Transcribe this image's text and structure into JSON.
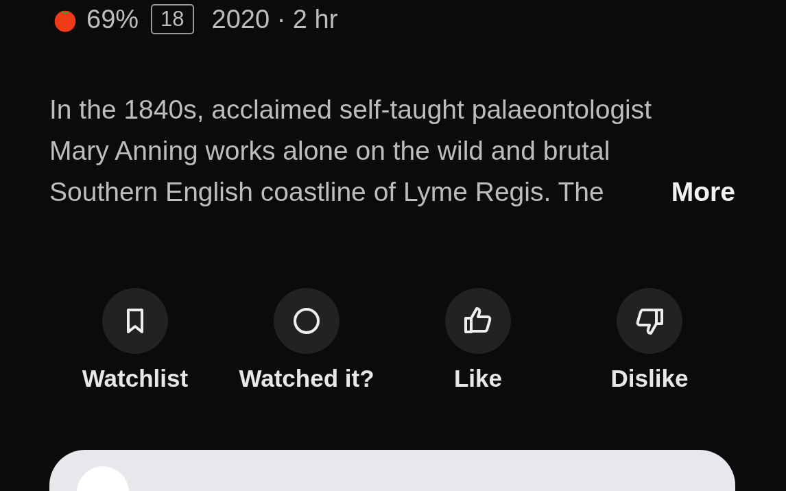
{
  "meta": {
    "score": "69%",
    "age_rating": "18",
    "year_runtime": "2020 · 2 hr"
  },
  "description": {
    "text": "In the 1840s, acclaimed self-taught palaeontologist Mary Anning works alone on the wild and brutal Southern English coastline of Lyme Regis. The",
    "more": "More"
  },
  "actions": [
    {
      "kind": "watchlist",
      "label": "Watchlist"
    },
    {
      "kind": "watched",
      "label": "Watched it?"
    },
    {
      "kind": "like",
      "label": "Like"
    },
    {
      "kind": "dislike",
      "label": "Dislike"
    }
  ]
}
